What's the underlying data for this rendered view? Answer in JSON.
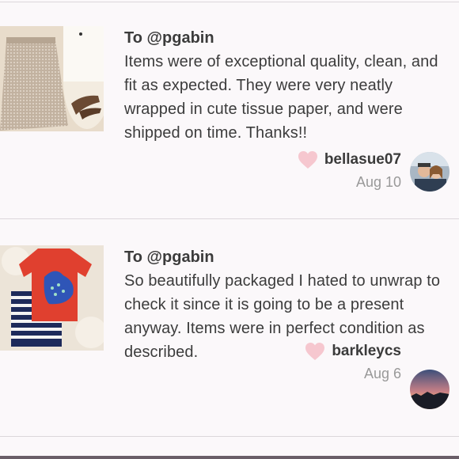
{
  "reviews": [
    {
      "to": "To @pgabin",
      "text": "Items were of exceptional quality, clean, and fit as expected. They were very neatly wrapped in cute tissue paper, and were shipped on time. Thanks!!",
      "username": "bellasue07",
      "date": "Aug 10",
      "thumb_icon": "skirt-photo",
      "avatar_icon": "couple-selfie-avatar"
    },
    {
      "to": "To @pgabin",
      "text": "So beautifully packaged I hated to unwrap to check it since it is going to be a present anyway. Items were in perfect condition as described.",
      "username": "barkleycs",
      "date": "Aug 6",
      "thumb_icon": "kids-outfit-photo",
      "avatar_icon": "sunset-avatar"
    }
  ],
  "colors": {
    "heart": "#f6c7cf",
    "background": "#fbf8fa",
    "date": "#999999"
  }
}
